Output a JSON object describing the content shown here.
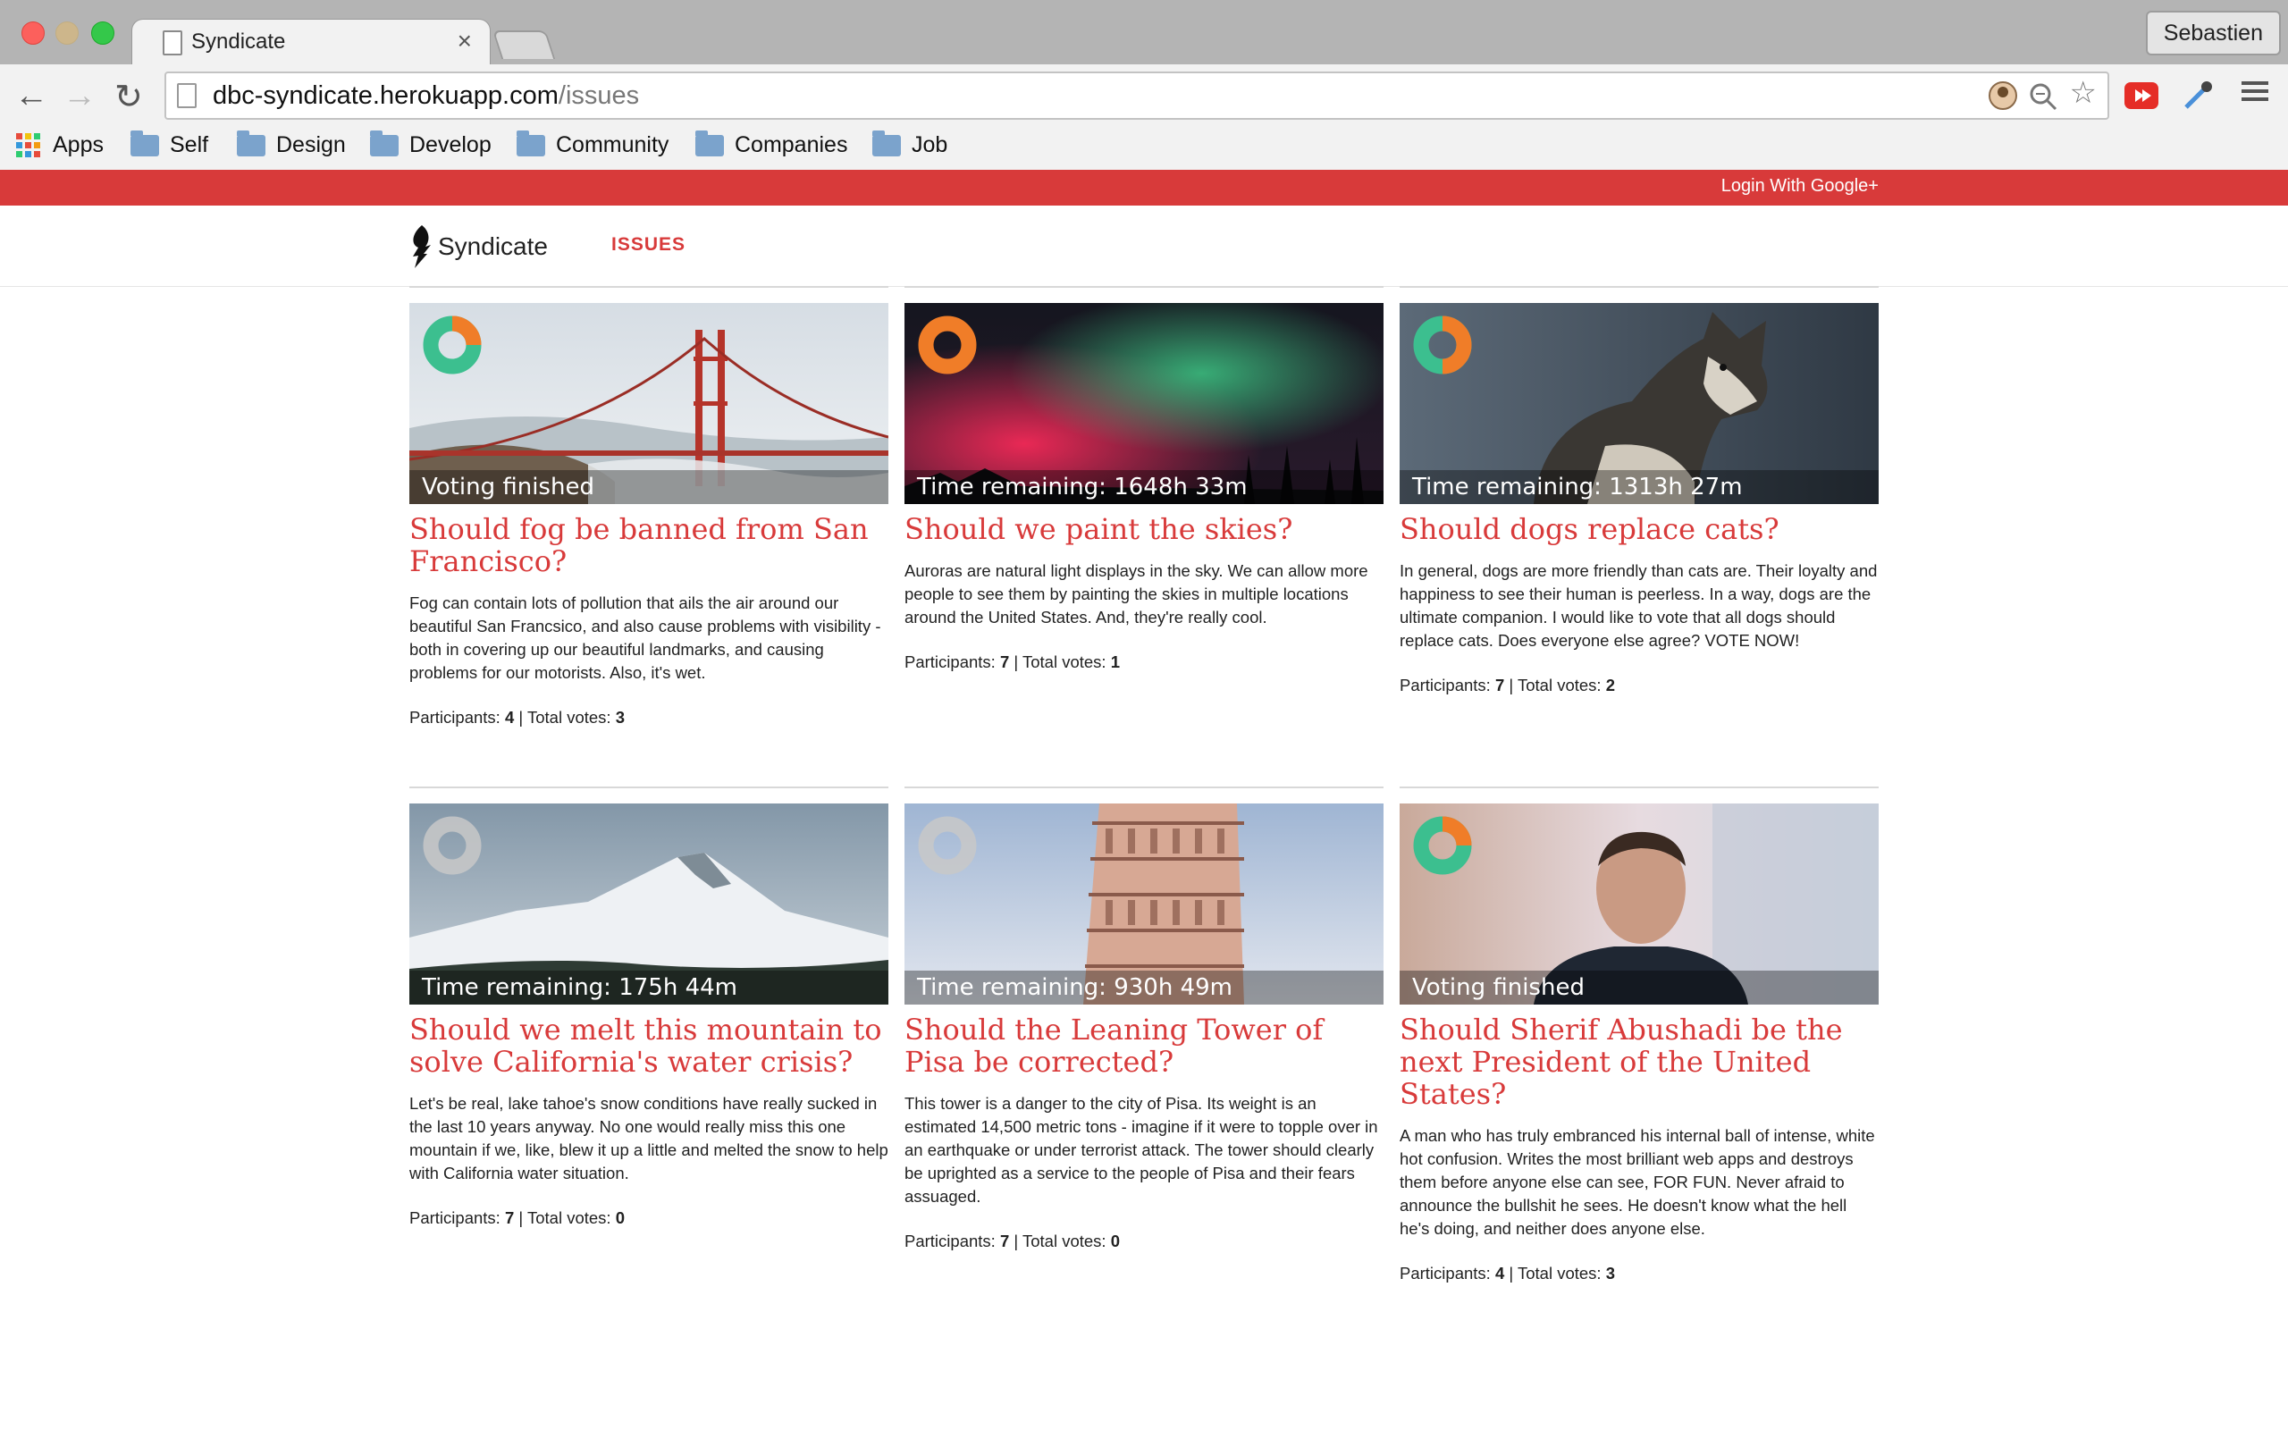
{
  "browser": {
    "tab_title": "Syndicate",
    "tab_close": "×",
    "profile_name": "Sebastien",
    "url_host": "dbc-syndicate.herokuapp.com",
    "url_path": "/issues",
    "bookmarks": [
      "Apps",
      "Self",
      "Design",
      "Develop",
      "Community",
      "Companies",
      "Job"
    ]
  },
  "site": {
    "login_label": "Login With Google+",
    "brand": "Syndicate",
    "nav_issues": "ISSUES",
    "colors": {
      "accent": "#d83a3a",
      "donut_orange": "#f07d28",
      "donut_teal": "#3cbf8f",
      "donut_inactive": "#c8c8c8"
    }
  },
  "labels": {
    "participants": "Participants:",
    "total_votes": "| Total votes:"
  },
  "issues": [
    {
      "time_label": "Voting finished",
      "title": "Should fog be banned from San Francisco?",
      "body": "Fog can contain lots of pollution that ails the air around our beautiful San Francsico, and also cause problems with visibility - both in covering up our beautiful landmarks, and causing problems for our motorists. Also, it's wet.",
      "participants": "4",
      "total_votes": "3"
    },
    {
      "time_label": "Time remaining: 1648h 33m",
      "title": "Should we paint the skies?",
      "body": "Auroras are natural light displays in the sky. We can allow more people to see them by painting the skies in multiple locations around the United States. And, they're really cool.",
      "participants": "7",
      "total_votes": "1"
    },
    {
      "time_label": "Time remaining: 1313h 27m",
      "title": "Should dogs replace cats?",
      "body": "In general, dogs are more friendly than cats are. Their loyalty and happiness to see their human is peerless. In a way, dogs are the ultimate companion. I would like to vote that all dogs should replace cats. Does everyone else agree? VOTE NOW!",
      "participants": "7",
      "total_votes": "2"
    },
    {
      "time_label": "Time remaining: 175h 44m",
      "title": "Should we melt this mountain to solve California's water crisis?",
      "body": "Let's be real, lake tahoe's snow conditions have really sucked in the last 10 years anyway. No one would really miss this one mountain if we, like, blew it up a little and melted the snow to help with California water situation.",
      "participants": "7",
      "total_votes": "0"
    },
    {
      "time_label": "Time remaining: 930h 49m",
      "title": "Should the Leaning Tower of Pisa be corrected?",
      "body": "This tower is a danger to the city of Pisa. Its weight is an estimated 14,500 metric tons - imagine if it were to topple over in an earthquake or under terrorist attack. The tower should clearly be uprighted as a service to the people of Pisa and their fears assuaged.",
      "participants": "7",
      "total_votes": "0"
    },
    {
      "time_label": "Voting finished",
      "title": "Should Sherif Abushadi be the next President of the United States?",
      "body": "A man who has truly embranced his internal ball of intense, white hot confusion. Writes the most brilliant web apps and destroys them before anyone else can see, FOR FUN. Never afraid to announce the bullshit he sees. He doesn't know what the hell he's doing, and neither does anyone else.",
      "participants": "4",
      "total_votes": "3"
    }
  ]
}
